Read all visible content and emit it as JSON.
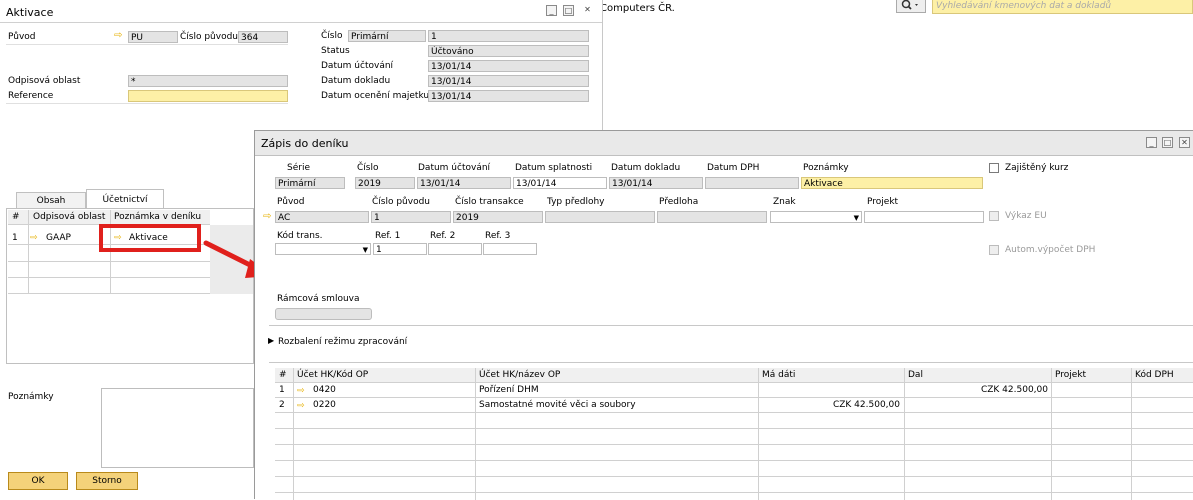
{
  "bg_window": {
    "company_text": "Computers ČR.",
    "search_placeholder": "Vyhledávání kmenových dat a dokladů"
  },
  "aktivace": {
    "title": "Aktivace",
    "puvod_label": "Původ",
    "puvod_value": "PU",
    "cislo_puvodu_label": "Číslo původu",
    "cislo_puvodu_value": "364",
    "odpisova_oblast_label": "Odpisová oblast",
    "odpisova_oblast_value": "*",
    "reference_label": "Reference",
    "cislo_label": "Číslo",
    "cislo_series": "Primární",
    "cislo_value": "1",
    "status_label": "Status",
    "status_value": "Účtováno",
    "datum_uctovani_label": "Datum účtování",
    "datum_uctovani_value": "13/01/14",
    "datum_dokladu_label": "Datum dokladu",
    "datum_dokladu_value": "13/01/14",
    "datum_oceneni_label": "Datum ocenění majetku",
    "datum_oceneni_value": "13/01/14",
    "tabs": [
      "Obsah",
      "Účetnictví"
    ],
    "grid_headers": [
      "#",
      "Odpisová oblast",
      "Poznámka v deníku"
    ],
    "grid_row": {
      "num": "1",
      "area": "GAAP",
      "note": "Aktivace"
    },
    "poznamky_label": "Poznámky",
    "ok_label": "OK",
    "storno_label": "Storno"
  },
  "zapis": {
    "title": "Zápis do deníku",
    "serie_label": "Série",
    "serie_value": "Primární",
    "cislo_label": "Číslo",
    "cislo_value": "2019",
    "datum_uctovani_label": "Datum účtování",
    "datum_uctovani_value": "13/01/14",
    "datum_splatnosti_label": "Datum splatnosti",
    "datum_splatnosti_value": "13/01/14",
    "datum_dokladu_label": "Datum dokladu",
    "datum_dokladu_value": "13/01/14",
    "datum_dph_label": "Datum DPH",
    "poznamky_label": "Poznámky",
    "poznamky_value": "Aktivace",
    "zajisteny_kurz_label": "Zajištěný kurz",
    "puvod_label": "Původ",
    "puvod_value": "AC",
    "cislo_puvodu_label": "Číslo původu",
    "cislo_puvodu_value": "1",
    "cislo_transakce_label": "Číslo transakce",
    "cislo_transakce_value": "2019",
    "typ_predlohy_label": "Typ předlohy",
    "predloha_label": "Předloha",
    "znak_label": "Znak",
    "projekt_label": "Projekt",
    "vykaz_eu_label": "Výkaz EU",
    "kod_trans_label": "Kód trans.",
    "ref1_label": "Ref. 1",
    "ref1_value": "1",
    "ref2_label": "Ref. 2",
    "ref3_label": "Ref. 3",
    "autom_dph_label": "Autom.výpočet DPH",
    "ramcova_smlouva_label": "Rámcová smlouva",
    "rozbaleni_label": "Rozbalení režimu zpracování",
    "table_headers": [
      "#",
      "Účet HK/Kód OP",
      "Účet HK/název OP",
      "Má dáti",
      "Dal",
      "Projekt",
      "Kód DPH"
    ],
    "rows": [
      {
        "num": "1",
        "account": "0420",
        "name": "Pořízení DHM",
        "debit": "",
        "credit": "CZK 42.500,00"
      },
      {
        "num": "2",
        "account": "0220",
        "name": "Samostatné movité věci a soubory",
        "debit": "CZK 42.500,00",
        "credit": ""
      }
    ]
  },
  "colors": {
    "highlight_red": "#e0201c",
    "yellow_field": "#fdf0a6",
    "button_yellow": "#f4d27a",
    "link_arrow": "#e6b000"
  }
}
